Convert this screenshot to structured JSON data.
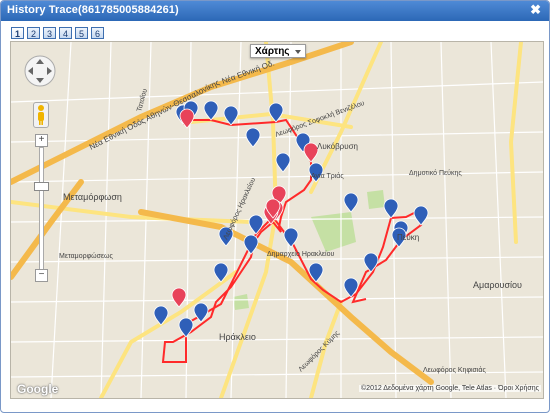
{
  "window": {
    "title": "History Trace(861785005884261)",
    "close_symbol": "✖"
  },
  "pagination": {
    "pages": [
      "1",
      "2",
      "3",
      "4",
      "5",
      "6"
    ],
    "current": "1"
  },
  "map": {
    "map_type_selector": "Χάρτης",
    "google_logo": "Google",
    "attribution": "©2012 Δεδομένα χάρτη Google, Tele Atlas · Όροι Χρήσης",
    "zoom_in_symbol": "+",
    "zoom_out_symbol": "−",
    "colors": {
      "land": "#ebe6d9",
      "highway": "#f4b94b",
      "major_road": "#fde480",
      "route_line": "#ff2a2a",
      "marker_blue": "#2f5fb8",
      "marker_red": "#e8435a",
      "park": "#c5e0a4"
    },
    "labels": {
      "metamorfosi": "Μεταμόρφωση",
      "metamorfoseos": "Μεταμορφώσεως",
      "irakleio": "Ηράκλειο",
      "amarousiou": "Αμαρουσίου",
      "pefki": "Πεύκη",
      "likovrysi": "Λυκόβρυση",
      "agia_trias": "Αγία Τριάς",
      "dimotiko_pefkis": "Δημοτικό Πεύκης",
      "dimarcheio_irakleiou": "Δημαρχείο Ηρακλείου",
      "ethniki_odos": "Νέα Εθνική Οδός Αθηνών-Θεσσαλονίκης",
      "ethniki_odos_short": "Νέα Εθνική Οδ.",
      "leoforos_irakleiou": "Λεωφόρος Ηρακλείου",
      "leoforos_kifisias": "Λεωφόρος Κηφισιάς",
      "leoforos_sofokli": "Λεωφόρος Σοφοκλή Βενιζέλου",
      "leoforos_kimis": "Λεωφόρος Κύμης",
      "tatoiou": "Τατοΐου"
    }
  }
}
